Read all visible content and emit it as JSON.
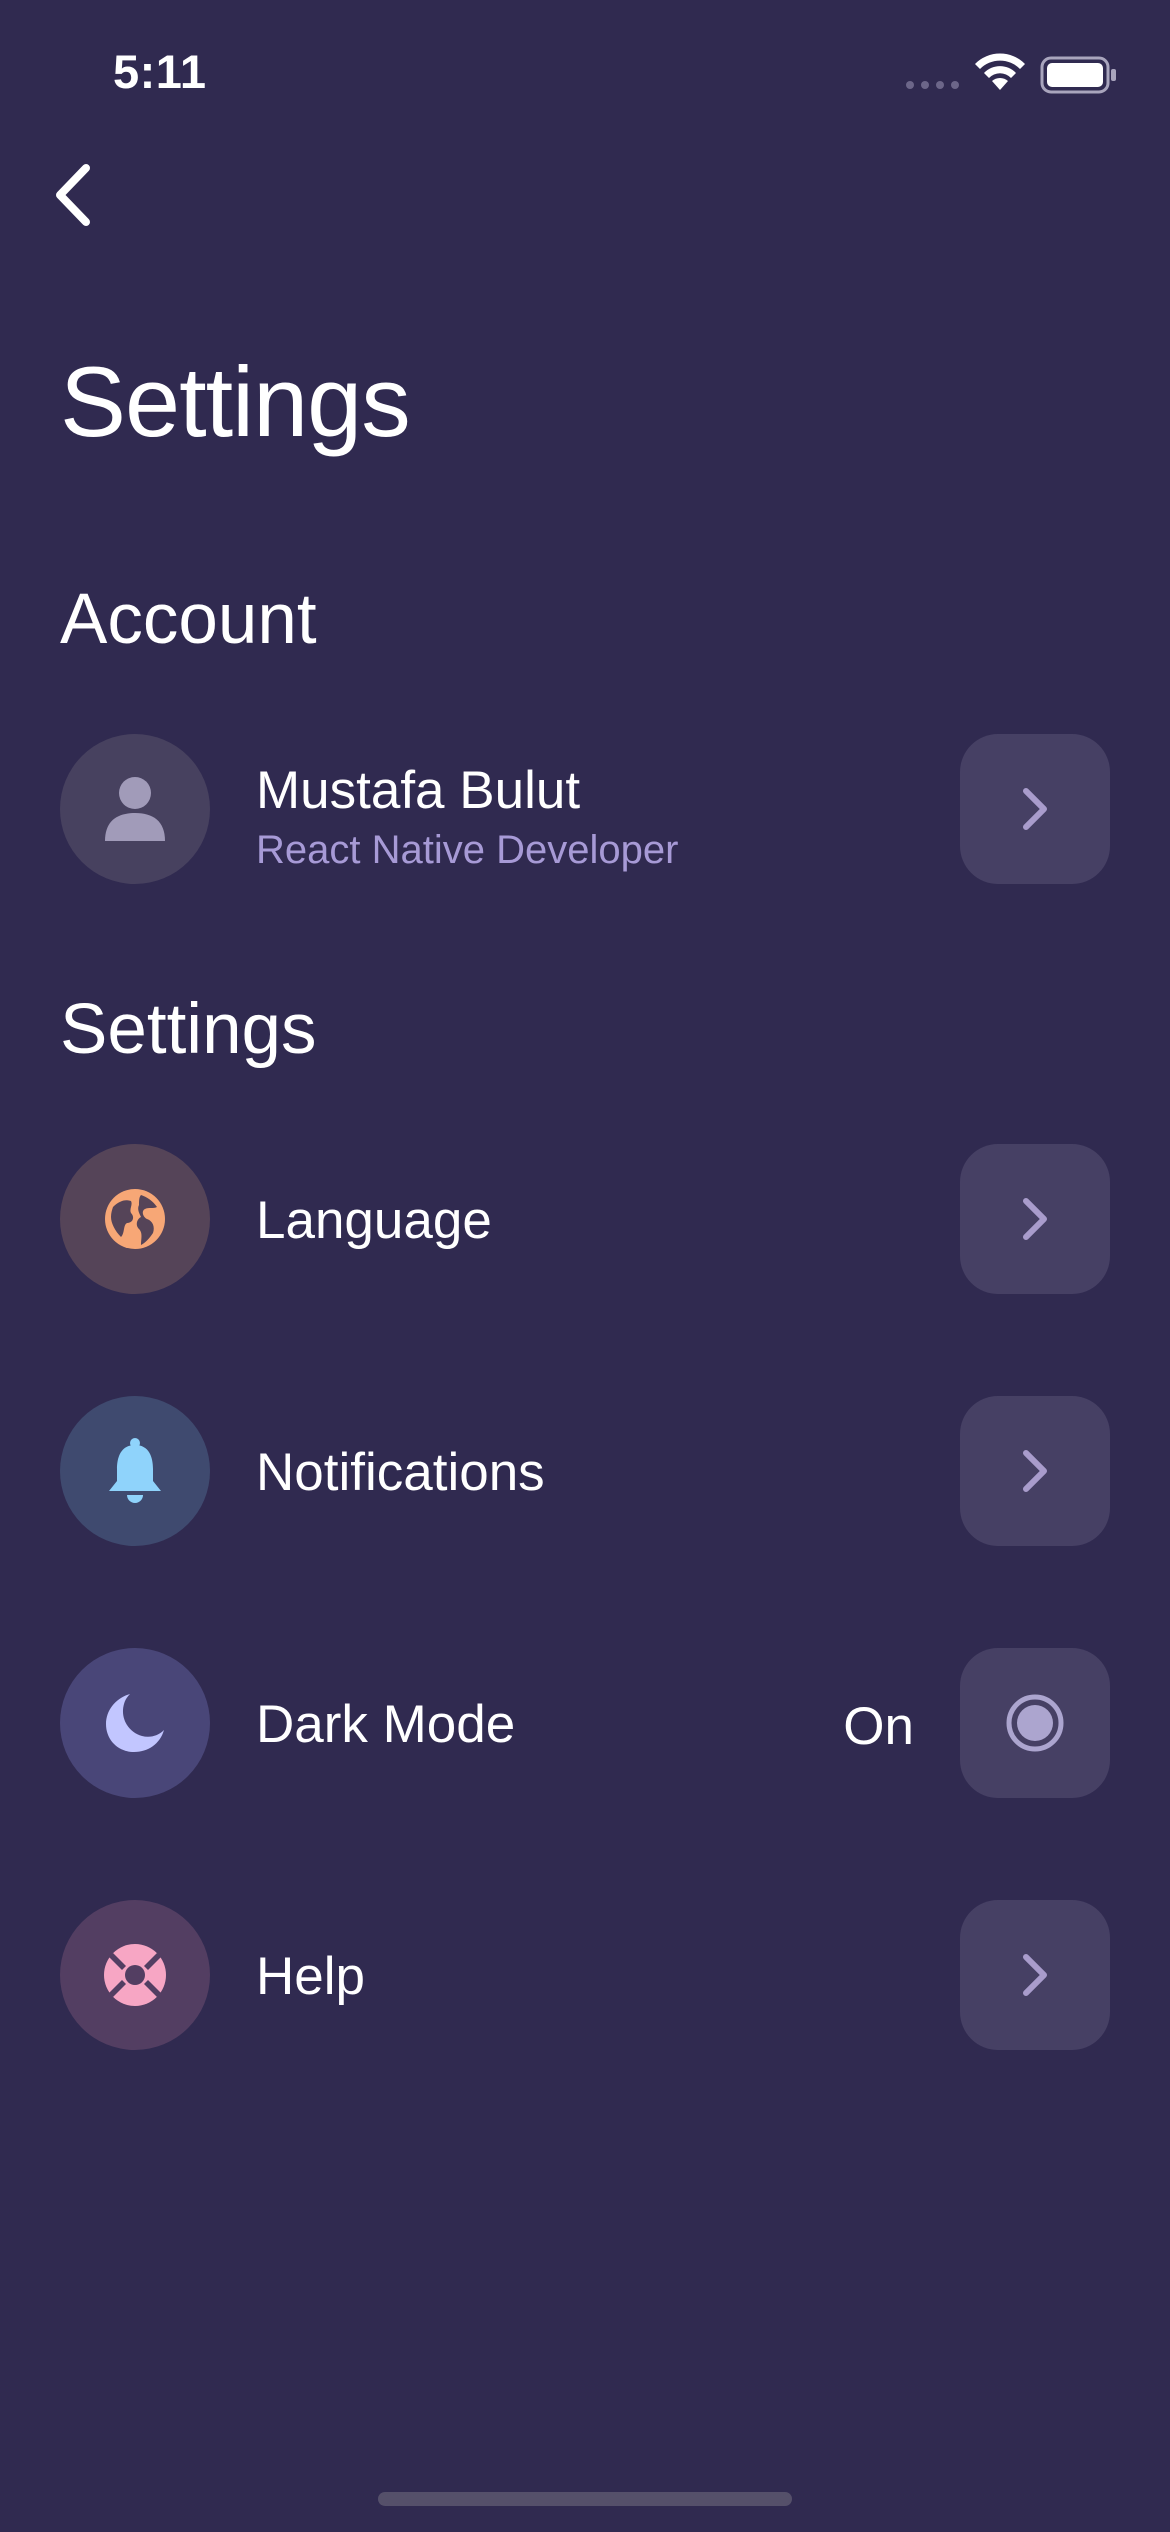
{
  "status_bar": {
    "time": "5:11",
    "icons": [
      "signal-dots-icon",
      "wifi-icon",
      "battery-icon"
    ]
  },
  "nav": {
    "back_icon": "chevron-left-icon"
  },
  "page": {
    "title": "Settings"
  },
  "account": {
    "section_title": "Account",
    "profile": {
      "name": "Mustafa Bulut",
      "role": "React Native Developer",
      "icon": "person-icon",
      "action_icon": "chevron-right-icon"
    }
  },
  "settings": {
    "section_title": "Settings",
    "items": [
      {
        "label": "Language",
        "icon": "globe-icon",
        "icon_color": "#f7a776",
        "circle_color": "#554458",
        "action_icon": "chevron-right-icon"
      },
      {
        "label": "Notifications",
        "icon": "bell-icon",
        "icon_color": "#8fd3fb",
        "circle_color": "#3f4a6f",
        "action_icon": "chevron-right-icon"
      },
      {
        "label": "Dark Mode",
        "value": "On",
        "icon": "moon-icon",
        "icon_color": "#c2c6ff",
        "circle_color": "#494678",
        "action_icon": "radio-on-icon"
      },
      {
        "label": "Help",
        "icon": "lifebuoy-icon",
        "icon_color": "#f7a6c4",
        "circle_color": "#533e62",
        "action_icon": "chevron-right-icon"
      }
    ]
  },
  "colors": {
    "background": "#302a50",
    "card": "#464064",
    "subtitle": "#a79ad6",
    "chevron": "#a99ccc"
  }
}
